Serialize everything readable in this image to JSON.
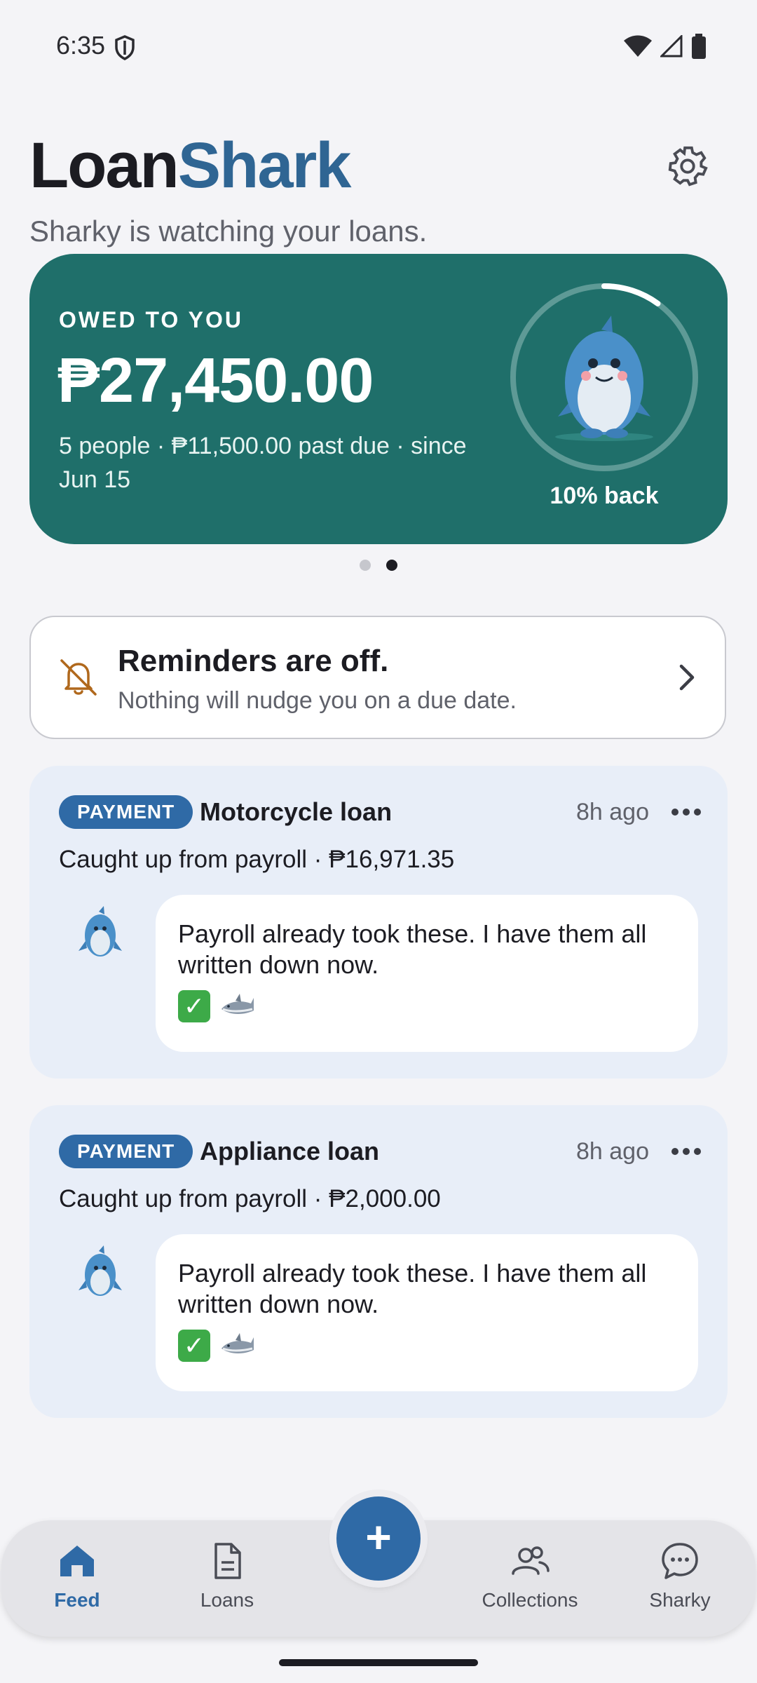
{
  "status_bar": {
    "time": "6:35"
  },
  "header": {
    "title_part1": "Loan",
    "title_part2": "Shark",
    "subtitle": "Sharky is watching your loans."
  },
  "owed_card": {
    "label": "OWED TO YOU",
    "amount": "₱27,450.00",
    "details": "5 people · ₱11,500.00 past due · since Jun 15",
    "progress_label": "10% back",
    "progress_fraction": 0.1
  },
  "carousel": {
    "pages": 2,
    "active": 1
  },
  "reminder": {
    "title": "Reminders are off.",
    "subtitle": "Nothing will nudge you on a due date."
  },
  "feed": [
    {
      "badge": "PAYMENT",
      "title": "Motorcycle loan",
      "time": "8h ago",
      "description": "Caught up from payroll · ₱16,971.35",
      "message": "Payroll already took these. I have them all written down now."
    },
    {
      "badge": "PAYMENT",
      "title": "Appliance loan",
      "time": "8h ago",
      "description": "Caught up from payroll · ₱2,000.00",
      "message": "Payroll already took these. I have them all written down now."
    }
  ],
  "nav": {
    "items": [
      {
        "label": "Feed",
        "icon": "home-icon"
      },
      {
        "label": "Loans",
        "icon": "document-icon"
      },
      {
        "label": "Collections",
        "icon": "people-icon"
      },
      {
        "label": "Sharky",
        "icon": "chat-icon"
      }
    ],
    "fab": "+"
  },
  "colors": {
    "brand": "#2f6593",
    "card": "#1f6f6a",
    "accent": "#2f6aa6"
  }
}
